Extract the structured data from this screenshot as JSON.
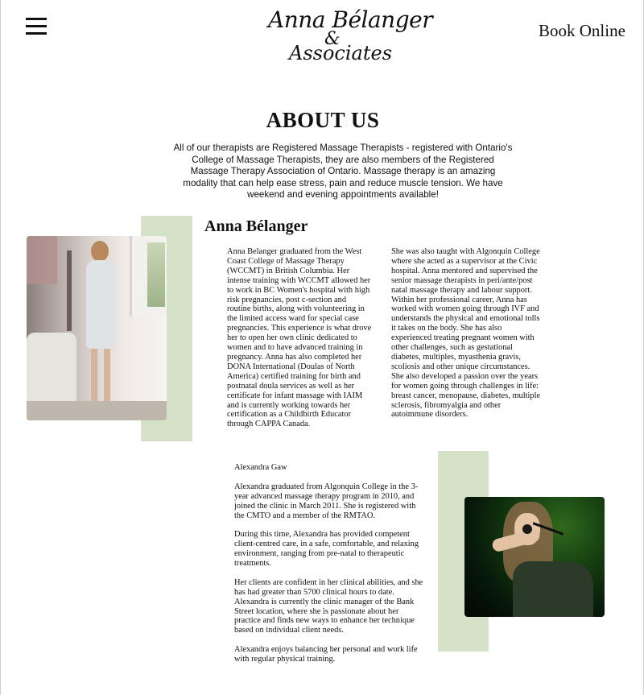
{
  "header": {
    "logo_line1": "Anna Bélanger",
    "logo_line2": "&",
    "logo_line3": "Associates",
    "book_online": "Book Online",
    "menu_icon": "hamburger-menu-icon"
  },
  "about": {
    "title": "ABOUT US",
    "intro": "All of our therapists are Registered Massage Therapists - registered with Ontario's College of Massage Therapists, they are also members of the Registered Massage Therapy Association of Ontario. Massage therapy is an amazing modality that can help ease stress, pain and reduce muscle tension. We have weekend and evening appointments available!"
  },
  "colors": {
    "accent_green": "#d4e2c7",
    "text": "#111111"
  },
  "therapists": [
    {
      "name": "Anna Bélanger",
      "bio_col1": "Anna Belanger graduated from the West Coast College of Massage Therapy (WCCMT) in British Columbia. Her intense training with WCCMT allowed her to work in BC Women's hospital with high risk pregnancies, post c-section and routine births, along with volunteering in the limited access ward for special case pregnancies. This experience is what drove her to open her own clinic dedicated to women and to have advanced training in pregnancy. Anna has also completed her DONA International (Doulas of North America) certified training for birth and postnatal doula services as well as her certificate for infant massage with IAIM and is currently working towards her certification as a Childbirth Educator through CAPPA Canada.",
      "bio_col2": "She was also taught with Algonquin College where she acted as a supervisor at the Civic hospital. Anna mentored and supervised the senior massage therapists in peri/ante/post natal massage therapy and labour support. Within her professional career, Anna has worked with women going through IVF and understands the physical and emotional tolls it takes on the body. She has also experienced treating pregnant women with other challenges, such as gestational diabetes, multiples, myasthenia gravis, scoliosis and other unique circumstances. She also developed a passion over the years for women going through challenges in life: breast cancer, menopause, diabetes, multiple sclerosis, fibromyalgia and other autoimmune disorders."
    },
    {
      "name": "Alexandra Gaw",
      "paragraphs": [
        "Alexandra graduated from Algonquin College in the 3-year advanced massage therapy program in 2010, and joined the clinic in March 2011.  She is registered with the CMTO and a member of  the RMTAO.",
        "During this time, Alexandra has provided competent client-centred care, in a safe, comfortable, and relaxing environment, ranging from pre-natal to therapeutic treatments.",
        "Her clients are confident in her clinical abilities, and she has had greater than 5700 clinical hours to date. Alexandra is currently the clinic manager of the Bank Street location, where she is passionate about her practice and finds new ways to enhance her technique based on individual client needs.",
        "Alexandra enjoys balancing her personal and work life with regular physical training."
      ]
    }
  ]
}
